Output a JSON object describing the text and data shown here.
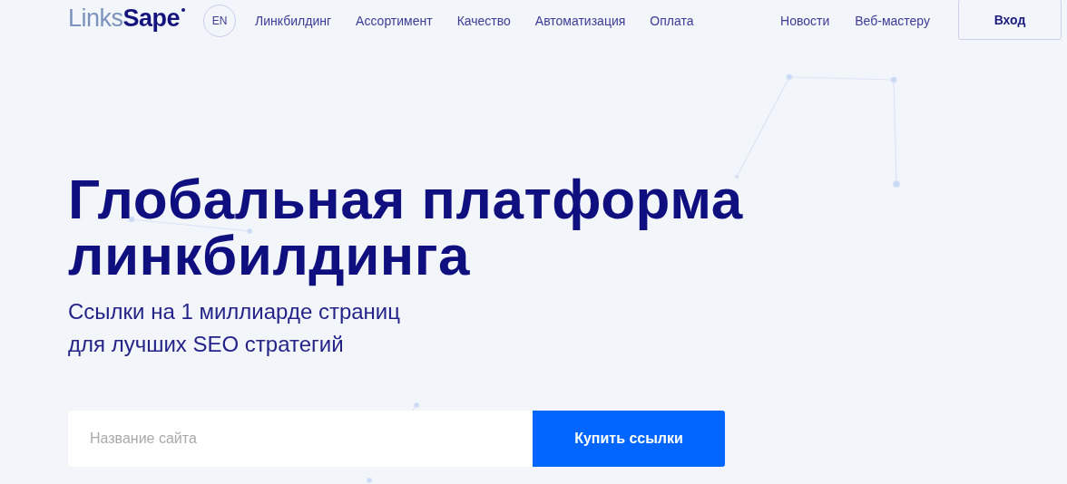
{
  "header": {
    "logo": {
      "part_1": "Links",
      "part_2": "Sape"
    },
    "language": "EN",
    "nav_left": [
      "Линкбилдинг",
      "Ассортимент",
      "Качество",
      "Автоматизация",
      "Оплата"
    ],
    "nav_right": [
      "Новости",
      "Веб-мастеру"
    ],
    "login_button": "Вход"
  },
  "hero": {
    "title_lines": [
      "Глобальная платформа",
      "линкбилдинга"
    ],
    "subtitle_lines": [
      "Ссылки на 1 миллиарде страниц",
      "для лучших SEO стратегий"
    ],
    "search": {
      "placeholder": "Название сайта"
    },
    "button": "Купить ссылки"
  }
}
